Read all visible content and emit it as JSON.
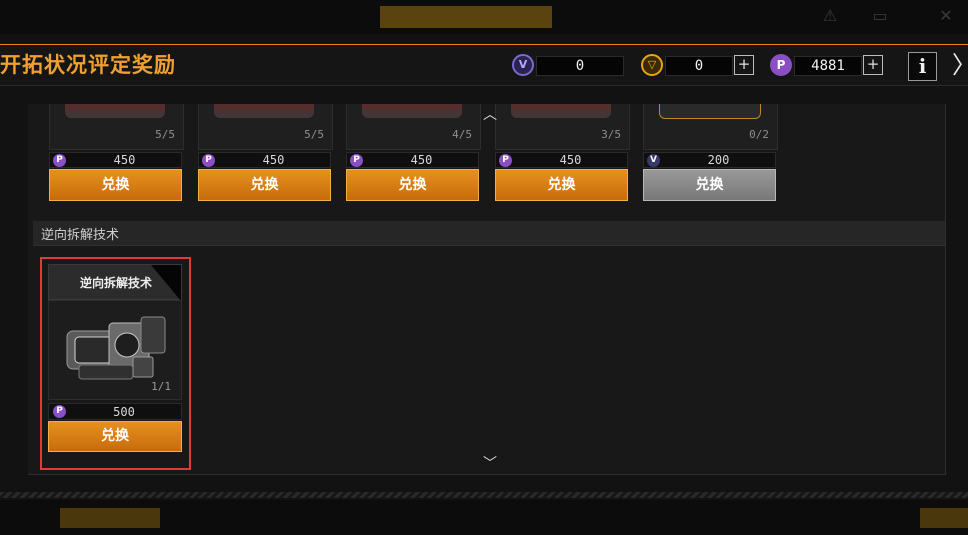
{
  "top_nav": {
    "tabs": [
      {
        "label": "·"
      },
      {
        "label": "·"
      },
      {
        "label": "·"
      }
    ]
  },
  "header": {
    "title": "开拓状况评定奖励",
    "currencies": [
      {
        "icon": "v-token-icon",
        "value": "0"
      },
      {
        "icon": "gold-token-icon",
        "value": "0"
      },
      {
        "icon": "p-token-icon",
        "value": "4881"
      }
    ],
    "info_label": "i"
  },
  "top_row": [
    {
      "count": "5/5",
      "price": "450",
      "button": "兑换",
      "currency": "p-token-icon"
    },
    {
      "count": "5/5",
      "price": "450",
      "button": "兑换",
      "currency": "p-token-icon"
    },
    {
      "count": "4/5",
      "price": "450",
      "button": "兑换",
      "currency": "p-token-icon"
    },
    {
      "count": "3/5",
      "price": "450",
      "button": "兑换",
      "currency": "p-token-icon"
    },
    {
      "count": "0/2",
      "price": "200",
      "button": "兑换",
      "currency": "v-token-icon"
    }
  ],
  "section": {
    "title": "逆向拆解技术",
    "item": {
      "name": "逆向拆解技术",
      "count": "1/1",
      "price": "500",
      "button": "兑换",
      "currency": "p-token-icon"
    }
  },
  "colors": {
    "accent": "#e7921f",
    "title": "#f0a030",
    "selection": "#e03a3a",
    "disabled_button": "#8a8a8a"
  }
}
